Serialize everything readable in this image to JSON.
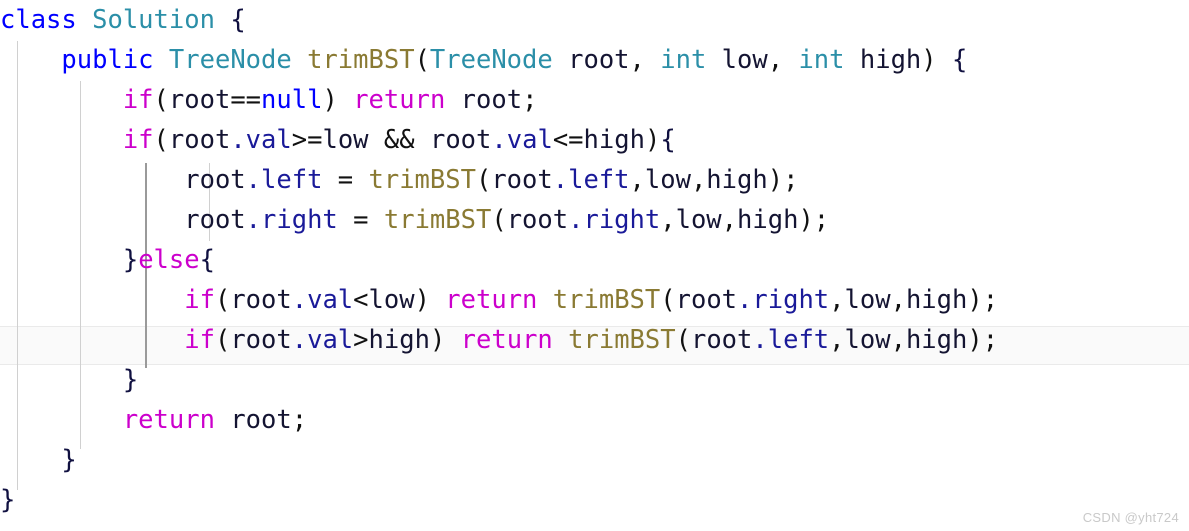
{
  "editor": {
    "language": "java",
    "current_line_number": 9,
    "background_color": "#ffffff",
    "current_line_highlight_color": "#fafafa",
    "indent_guide_color": "#d0d0d0",
    "active_indent_guide_color": "#9a9a9a"
  },
  "palette": {
    "keyword": "#0000ff",
    "control_keyword": "#cc00cc",
    "type": "#2b8fa8",
    "method": "#8a7a33",
    "identifier": "#141432",
    "field": "#1a1a99",
    "punctuation": "#111111"
  },
  "watermark": {
    "text": "CSDN @yht724"
  },
  "code": {
    "plain_text": "class Solution {\n    public TreeNode trimBST(TreeNode root, int low, int high) {\n        if(root==null) return root;\n        if(root.val>=low && root.val<=high){\n            root.left = trimBST(root.left,low,high);\n            root.right = trimBST(root.right,low,high);\n        }else{\n            if(root.val<low) return trimBST(root.right,low,high);\n            if(root.val>high) return trimBST(root.left,low,high);\n        }\n        return root;\n    }\n}",
    "lines": [
      {
        "n": 1,
        "indent": 0,
        "text": "class Solution {"
      },
      {
        "n": 2,
        "indent": 1,
        "text": "public TreeNode trimBST(TreeNode root, int low, int high) {"
      },
      {
        "n": 3,
        "indent": 2,
        "text": "if(root==null) return root;"
      },
      {
        "n": 4,
        "indent": 2,
        "text": "if(root.val>=low && root.val<=high){"
      },
      {
        "n": 5,
        "indent": 3,
        "text": "root.left = trimBST(root.left,low,high);"
      },
      {
        "n": 6,
        "indent": 3,
        "text": "root.right = trimBST(root.right,low,high);"
      },
      {
        "n": 7,
        "indent": 2,
        "text": "}else{"
      },
      {
        "n": 8,
        "indent": 3,
        "text": "if(root.val<low) return trimBST(root.right,low,high);"
      },
      {
        "n": 9,
        "indent": 3,
        "text": "if(root.val>high) return trimBST(root.left,low,high);"
      },
      {
        "n": 10,
        "indent": 2,
        "text": "}"
      },
      {
        "n": 11,
        "indent": 2,
        "text": "return root;"
      },
      {
        "n": 12,
        "indent": 1,
        "text": "}"
      },
      {
        "n": 13,
        "indent": 0,
        "text": "}"
      }
    ],
    "tokens": {
      "l1": {
        "kw": "class",
        "sp1": " ",
        "type": "Solution",
        "sp2": " ",
        "brace": "{"
      },
      "l2": {
        "kw": "public",
        "sp1": " ",
        "type1": "TreeNode",
        "sp2": " ",
        "fn": "trimBST",
        "p1": "(",
        "type2": "TreeNode",
        "sp3": " ",
        "id1": "root",
        "c1": ", ",
        "type3": "int",
        "sp4": " ",
        "id2": "low",
        "c2": ", ",
        "type4": "int",
        "sp5": " ",
        "id3": "high",
        "p2": ")",
        "sp6": " ",
        "brace": "{"
      },
      "l3": {
        "ctrl1": "if",
        "p1": "(",
        "id1": "root",
        "op": "==",
        "kw": "null",
        "p2": ")",
        "sp": " ",
        "ctrl2": "return",
        "sp2": " ",
        "id2": "root",
        "semi": ";"
      },
      "l4": {
        "ctrl": "if",
        "p1": "(",
        "id1": "root",
        "f1": ".val",
        "op1": ">=",
        "id2": "low",
        "sp1": " ",
        "amp": "&&",
        "sp2": " ",
        "id3": "root",
        "f2": ".val",
        "op2": "<=",
        "id4": "high",
        "p2": ")",
        "brace": "{"
      },
      "l5": {
        "id1": "root",
        "f1": ".left",
        "sp1": " ",
        "eq": "=",
        "sp2": " ",
        "fn": "trimBST",
        "p1": "(",
        "id2": "root",
        "f2": ".left",
        "c1": ",",
        "id3": "low",
        "c2": ",",
        "id4": "high",
        "p2": ")",
        "semi": ";"
      },
      "l6": {
        "id1": "root",
        "f1": ".right",
        "sp1": " ",
        "eq": "=",
        "sp2": " ",
        "fn": "trimBST",
        "p1": "(",
        "id2": "root",
        "f2": ".right",
        "c1": ",",
        "id3": "low",
        "c2": ",",
        "id4": "high",
        "p2": ")",
        "semi": ";"
      },
      "l7": {
        "b1": "}",
        "ctrl": "else",
        "b2": "{"
      },
      "l8": {
        "ctrl1": "if",
        "p1": "(",
        "id1": "root",
        "f1": ".val",
        "op": "<",
        "id2": "low",
        "p2": ")",
        "sp": " ",
        "ctrl2": "return",
        "sp2": " ",
        "fn": "trimBST",
        "p3": "(",
        "id3": "root",
        "f2": ".right",
        "c1": ",",
        "id4": "low",
        "c2": ",",
        "id5": "high",
        "p4": ")",
        "semi": ";"
      },
      "l9": {
        "ctrl1": "if",
        "p1": "(",
        "id1": "root",
        "f1": ".val",
        "op": ">",
        "id2": "high",
        "p2": ")",
        "sp": " ",
        "ctrl2": "return",
        "sp2": " ",
        "fn": "trimBST",
        "p3": "(",
        "id3": "root",
        "f2": ".left",
        "c1": ",",
        "id4": "low",
        "c2": ",",
        "id5": "high",
        "p4": ")",
        "semi": ";"
      },
      "l10": {
        "brace": "}"
      },
      "l11": {
        "ctrl": "return",
        "sp": " ",
        "id": "root",
        "semi": ";"
      },
      "l12": {
        "brace": "}"
      },
      "l13": {
        "brace": "}"
      }
    },
    "indent_units": {
      "i1": "    ",
      "i2": "        ",
      "i3": "            "
    }
  }
}
